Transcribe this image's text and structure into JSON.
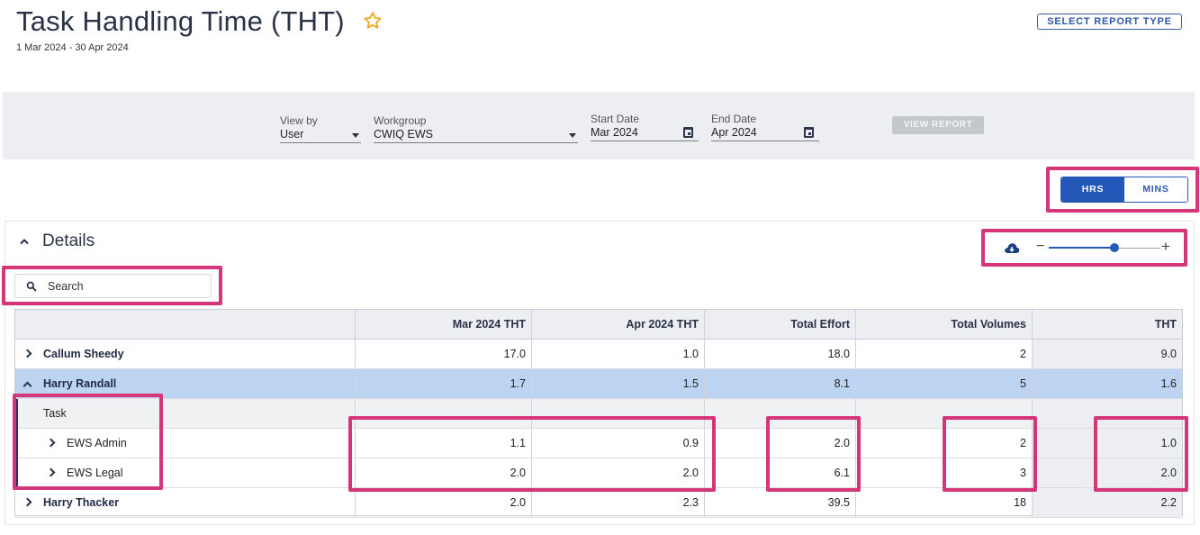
{
  "header": {
    "title": "Task Handling Time (THT)",
    "date_range": "1 Mar 2024 - 30 Apr 2024",
    "select_report_label": "SELECT REPORT TYPE"
  },
  "filters": {
    "view_by": {
      "label": "View by",
      "value": "User"
    },
    "workgroup": {
      "label": "Workgroup",
      "value": "CWIQ EWS"
    },
    "start_date": {
      "label": "Start Date",
      "value": "Mar 2024"
    },
    "end_date": {
      "label": "End Date",
      "value": "Apr 2024"
    },
    "view_report_label": "VIEW REPORT"
  },
  "unit_toggle": {
    "hrs": "HRS",
    "mins": "MINS",
    "selected": "HRS"
  },
  "details": {
    "title": "Details",
    "zoom_level": 0.6,
    "search_placeholder": "Search"
  },
  "table": {
    "columns": [
      "",
      "Mar 2024 THT",
      "Apr 2024 THT",
      "Total Effort",
      "Total Volumes",
      "THT"
    ],
    "rows": [
      {
        "name": "Callum Sheedy",
        "mar": "17.0",
        "apr": "1.0",
        "effort": "18.0",
        "volumes": "2",
        "tht": "9.0"
      },
      {
        "name": "Harry Randall",
        "mar": "1.7",
        "apr": "1.5",
        "effort": "8.1",
        "volumes": "5",
        "tht": "1.6"
      },
      {
        "name": "Task"
      },
      {
        "name": "EWS Admin",
        "mar": "1.1",
        "apr": "0.9",
        "effort": "2.0",
        "volumes": "2",
        "tht": "1.0"
      },
      {
        "name": "EWS Legal",
        "mar": "2.0",
        "apr": "2.0",
        "effort": "6.1",
        "volumes": "3",
        "tht": "2.0"
      },
      {
        "name": "Harry Thacker",
        "mar": "2.0",
        "apr": "2.3",
        "effort": "39.5",
        "volumes": "18",
        "tht": "2.2"
      }
    ]
  },
  "colors": {
    "accent": "#2358b8",
    "highlight": "#d43679",
    "selected_row": "#bcd3f2",
    "star": "#f0a81c"
  }
}
